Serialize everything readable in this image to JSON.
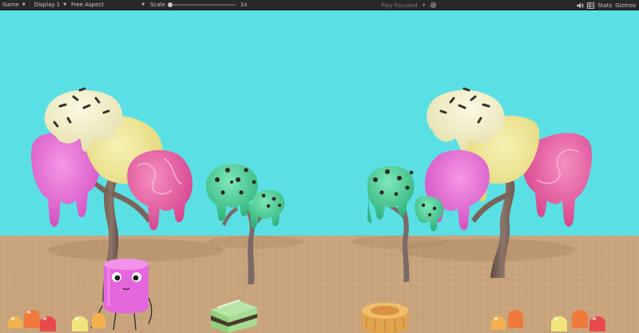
{
  "toolbar": {
    "view_label": "Game",
    "display_label": "Display 1",
    "aspect_label": "Free Aspect",
    "scale_label": "Scale",
    "scale_value": "1x",
    "scale_slider_fraction": 0.0,
    "play_mode_label": "Play Focused",
    "stats_label": "Stats",
    "gizmos_label": "Gizmos"
  },
  "icons": {
    "view": "gamepad-icon",
    "dropdown": "chevron-down-icon",
    "settings": "gear-icon",
    "audio": "speaker-icon",
    "layout": "grid-icon"
  },
  "colors": {
    "toolbar_bg": "#282828",
    "sky": "#5ae0e4",
    "ground": "#c9a57e",
    "scoop_cream": "#f2efc4",
    "scoop_yellow": "#ede38e",
    "scoop_pink": "#e35a9d",
    "scoop_magenta": "#ea66d4",
    "scoop_mint": "#46cf95",
    "marshmallow": "#e567dc"
  }
}
